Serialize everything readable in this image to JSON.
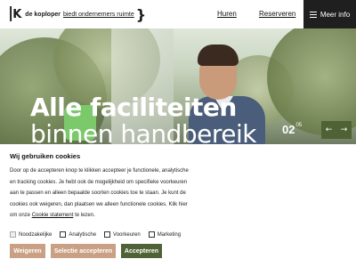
{
  "header": {
    "logo": {
      "brand": "de koploper",
      "tagline": "biedt ondernemers ruimte"
    },
    "nav": [
      {
        "label": "Huren"
      },
      {
        "label": "Reserveren"
      }
    ],
    "menu_label": "Meer info"
  },
  "hero": {
    "title": "Alle faciliteiten",
    "subtitle": "binnen handbereik",
    "slide_current": "02",
    "slide_total": "05",
    "prev_arrow": "←",
    "next_arrow": "→"
  },
  "cookie": {
    "title": "Wij gebruiken cookies",
    "text_before_link": "Door op de accepteren knop te klikken accepteer je functionele, analytische en tracking cookies. Je hebt ook de mogelijkheid om specifieke voorkeuren aan te passen en alleen bepaalde soorten cookies toe te staan. Je kunt de cookies ook weigeren, dan plaatsen we alleen functionele cookies. Klik hier om onze",
    "link_text": "Cookie statement",
    "text_after_link": "te lezen.",
    "options": [
      {
        "label": "Noodzakelijke",
        "checked": false,
        "disabled": true
      },
      {
        "label": "Analytische",
        "checked": false,
        "disabled": false
      },
      {
        "label": "Voorkeuren",
        "checked": false,
        "disabled": false
      },
      {
        "label": "Marketing",
        "checked": false,
        "disabled": false
      }
    ],
    "buttons": {
      "reject": "Weigeren",
      "accept_selection": "Selectie accepteren",
      "accept": "Accepteren"
    }
  },
  "colors": {
    "brand_green": "#4f6236",
    "button_tan": "#c9a083",
    "menu_dark": "#1f1f1f"
  }
}
